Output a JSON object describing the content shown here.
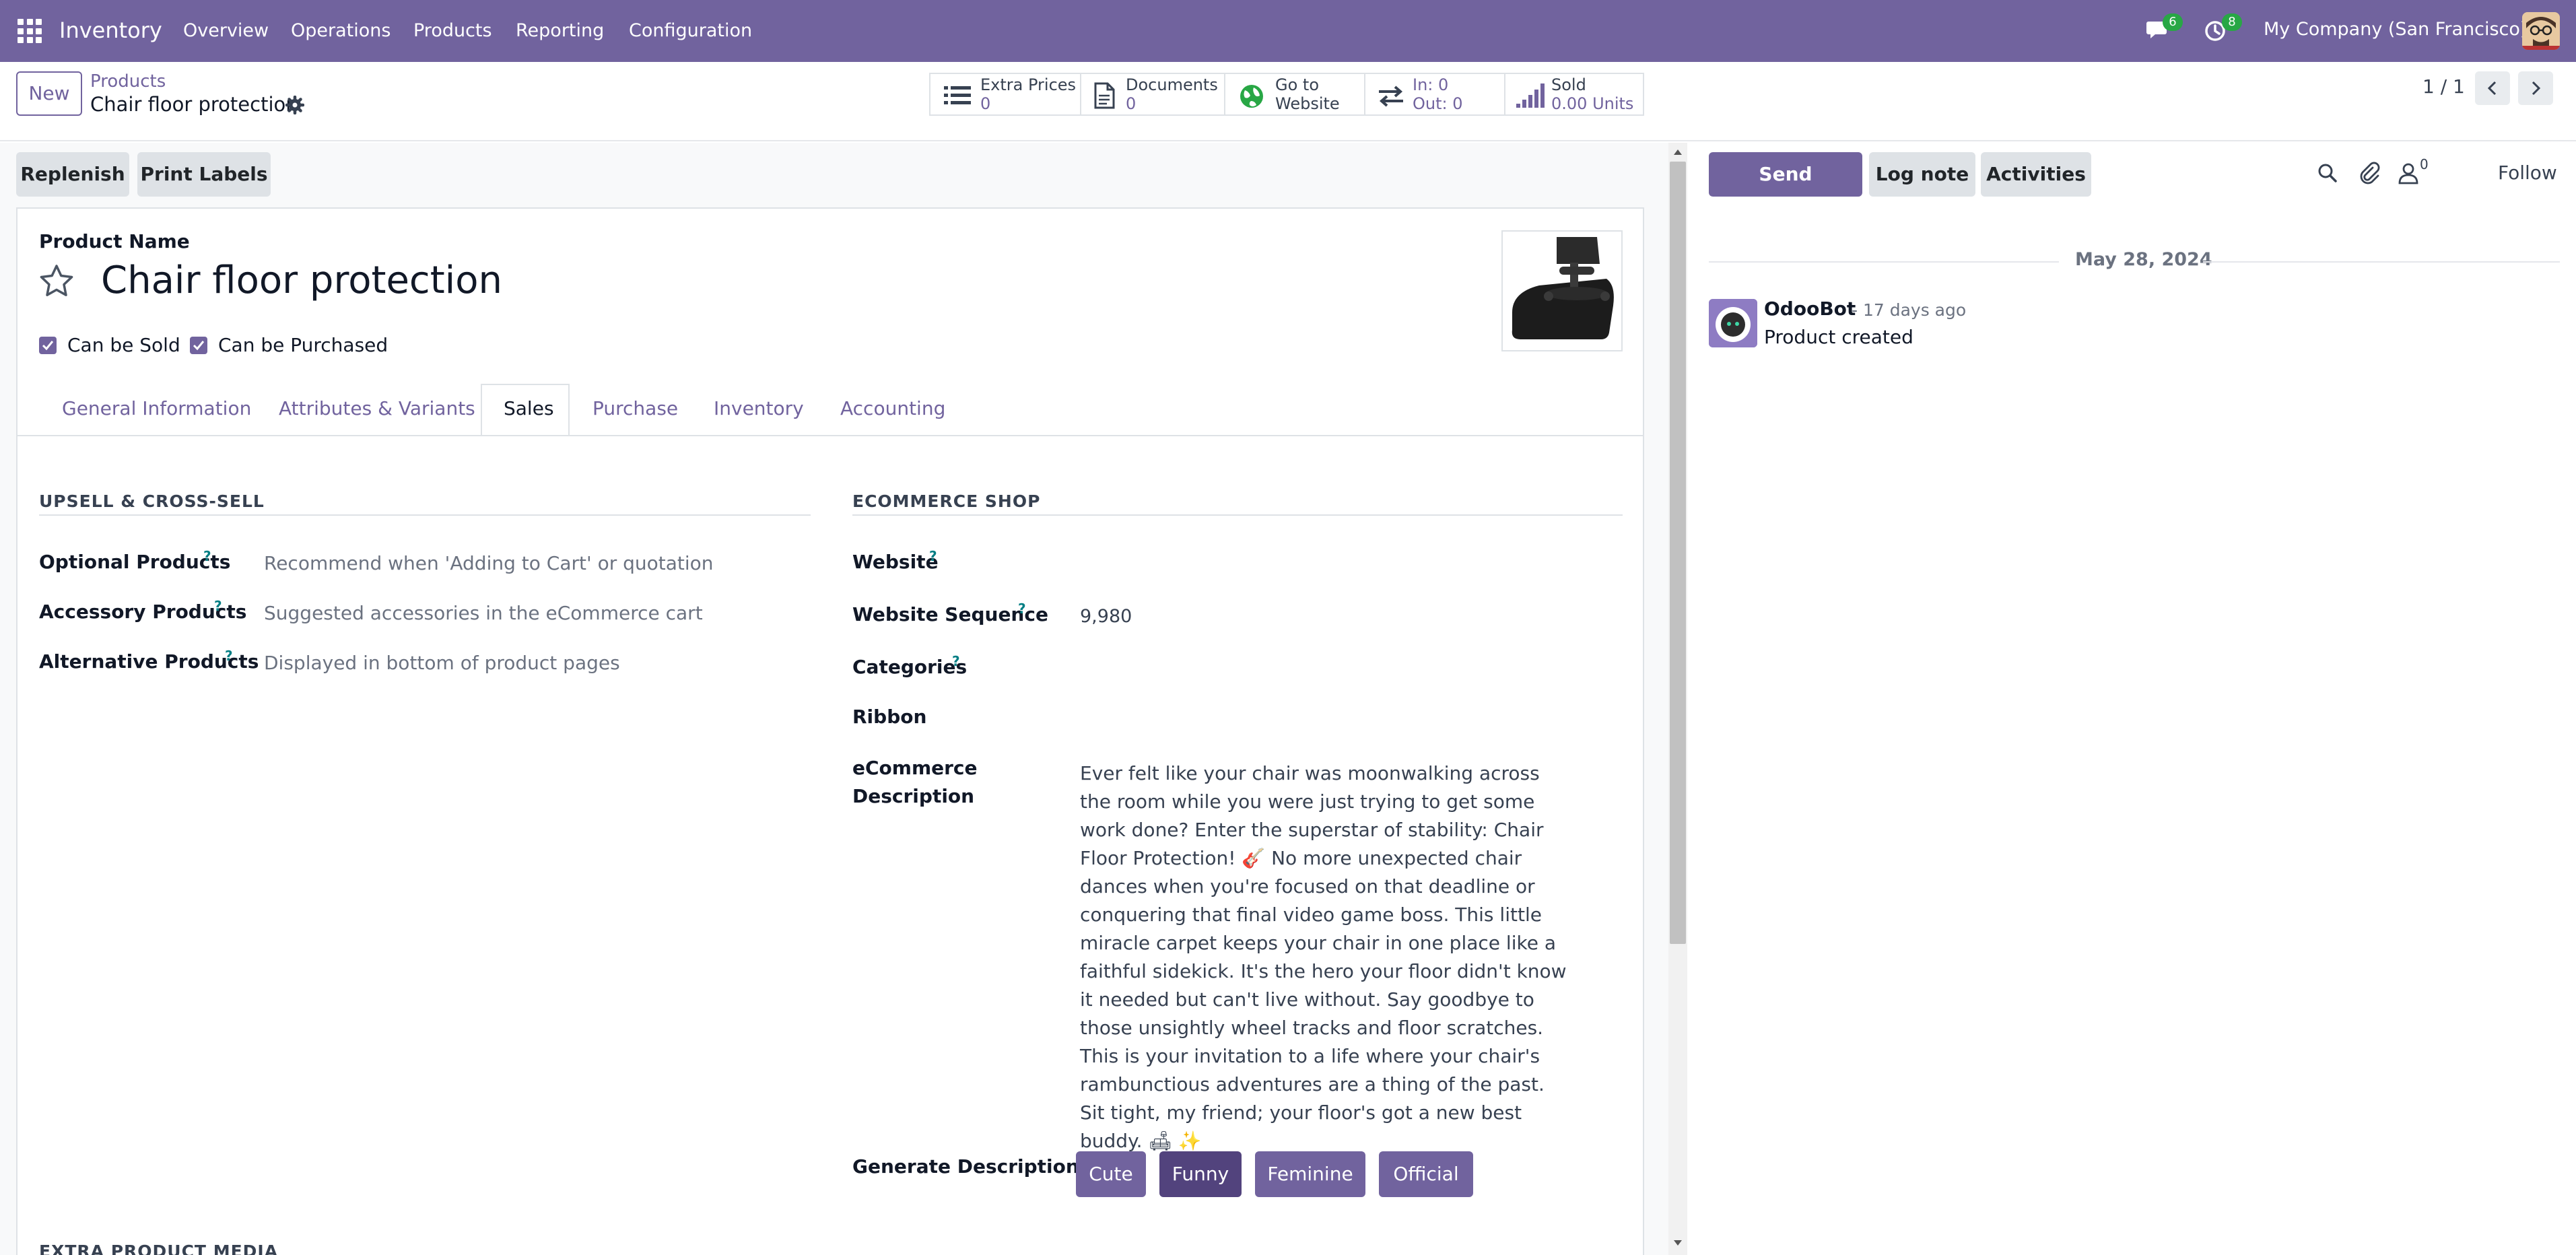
{
  "navbar": {
    "app_name": "Inventory",
    "menu": [
      "Overview",
      "Operations",
      "Products",
      "Reporting",
      "Configuration"
    ],
    "messages_count": "6",
    "activities_count": "8",
    "company": "My Company (San Francisco)"
  },
  "control_panel": {
    "new_label": "New",
    "breadcrumb_parent": "Products",
    "breadcrumb_current": "Chair floor protection",
    "smart_buttons": {
      "extra_prices": {
        "label": "Extra Prices",
        "value": "0"
      },
      "documents": {
        "label": "Documents",
        "value": "0"
      },
      "website": {
        "label1": "Go to",
        "label2": "Website"
      },
      "moves": {
        "in": "In: 0",
        "out": "Out: 0"
      },
      "sold": {
        "label": "Sold",
        "value": "0.00 Units"
      }
    },
    "pager": "1 / 1"
  },
  "actions": {
    "replenish": "Replenish",
    "print_labels": "Print Labels"
  },
  "product": {
    "name_label": "Product Name",
    "name": "Chair floor protection",
    "can_be_sold": "Can be Sold",
    "can_be_purchased": "Can be Purchased"
  },
  "tabs": [
    "General Information",
    "Attributes & Variants",
    "Sales",
    "Purchase",
    "Inventory",
    "Accounting"
  ],
  "active_tab": "Sales",
  "upsell": {
    "title": "UPSELL & CROSS-SELL",
    "optional_label": "Optional Products",
    "optional_placeholder": "Recommend when 'Adding to Cart' or quotation",
    "accessory_label": "Accessory Products",
    "accessory_placeholder": "Suggested accessories in the eCommerce cart",
    "alternative_label": "Alternative Products",
    "alternative_placeholder": "Displayed in bottom of product pages"
  },
  "ecommerce": {
    "title": "ECOMMERCE SHOP",
    "website_label": "Website",
    "sequence_label": "Website Sequence",
    "sequence_value": "9,980",
    "categories_label": "Categories",
    "ribbon_label": "Ribbon",
    "desc_label_1": "eCommerce",
    "desc_label_2": "Description",
    "description": "Ever felt like your chair was moonwalking across the room while you were just trying to get some work done? Enter the superstar of stability: Chair Floor Protection! 🎸 No more unexpected chair dances when you're focused on that deadline or conquering that final video game boss. This little miracle carpet keeps your chair in one place like a faithful sidekick. It's the hero your floor didn't know it needed but can't live without. Say goodbye to those unsightly wheel tracks and floor scratches. This is your invitation to a life where your chair's rambunctious adventures are a thing of the past. Sit tight, my friend; your floor's got a new best buddy. 🛋 ✨",
    "generate_label": "Generate Description",
    "generate_options": [
      "Cute",
      "Funny",
      "Feminine",
      "Official"
    ],
    "generate_selected": "Funny"
  },
  "extra_media_title": "EXTRA PRODUCT MEDIA",
  "chatter": {
    "send_message": "Send message",
    "log_note": "Log note",
    "activities": "Activities",
    "followers_count": "0",
    "follow": "Follow",
    "date": "May 28, 2024",
    "message": {
      "author": "OdooBot",
      "time": "- 17 days ago",
      "body": "Product created"
    }
  },
  "colors": {
    "brand": "#71639e",
    "badge": "#28a745",
    "link": "#017e84"
  }
}
